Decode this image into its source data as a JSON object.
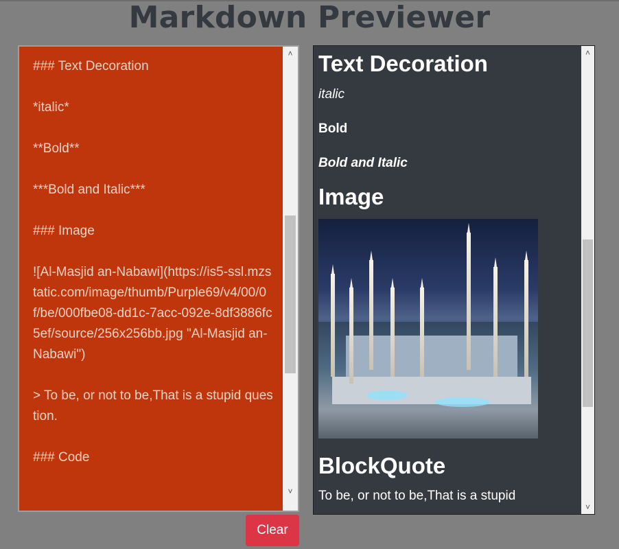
{
  "header": {
    "title": "Markdown Previewer"
  },
  "editor": {
    "lines": [
      "### Text Decoration",
      "*italic*",
      "**Bold**",
      "***Bold and Italic***",
      "### Image",
      "![Al-Masjid an-Nabawi](https://is5-ssl.mzstatic.com/image/thumb/Purple69/v4/00/0f/be/000fbe08-dd1c-7acc-092e-8df3886fc5ef/source/256x256bb.jpg \"Al-Masjid an-Nabawi\")",
      "> To be, or not to be,That is a stupid question.",
      "### Code"
    ]
  },
  "preview": {
    "heading_text_decoration": "Text Decoration",
    "italic": "italic",
    "bold": "Bold",
    "bold_italic": "Bold and Italic",
    "heading_image": "Image",
    "image_alt": "Al-Masjid an-Nabawi",
    "heading_blockquote": "BlockQuote",
    "blockquote": "To be, or not to be,That is a stupid"
  },
  "buttons": {
    "clear": "Clear"
  },
  "icons": {
    "scroll_up": "chevron-up-icon",
    "scroll_down": "chevron-down-icon",
    "resize": "resize-grip-icon"
  },
  "colors": {
    "page_background": "#808080",
    "title": "#343a40",
    "editor_background": "#c0360c",
    "preview_background": "#343a40",
    "clear_button": "#dc3545"
  }
}
